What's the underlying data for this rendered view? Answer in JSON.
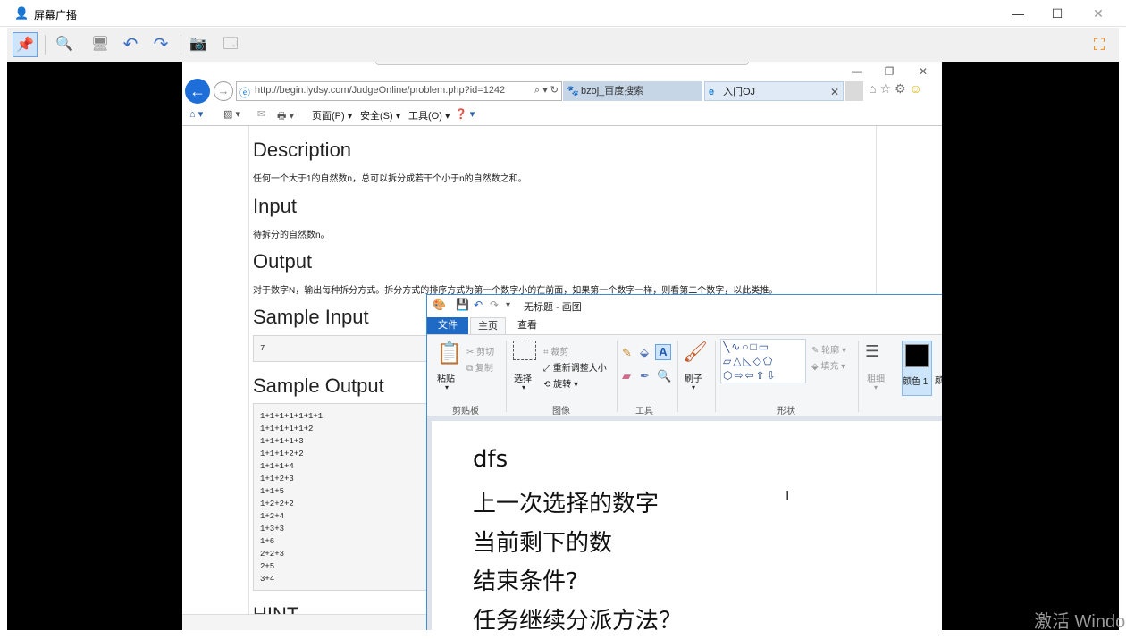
{
  "window": {
    "title": "屏幕广播",
    "controls": {
      "minimize": "—",
      "maximize": "☐",
      "close": "✕"
    }
  },
  "toolbar": {
    "buttons": [
      {
        "name": "pin-icon",
        "glyph": "📌"
      },
      {
        "name": "zoom-icon",
        "glyph": "🔍"
      },
      {
        "name": "monitor-icon",
        "glyph": "🖥"
      },
      {
        "name": "undo-icon",
        "glyph": "↶"
      },
      {
        "name": "redo-icon",
        "glyph": "↷"
      },
      {
        "name": "camera-icon",
        "glyph": "📷"
      },
      {
        "name": "screens-icon",
        "glyph": "🗔"
      }
    ],
    "fullscreen_glyph": "⛶"
  },
  "browser": {
    "controls": {
      "minimize": "—",
      "restore": "❐",
      "close": "✕"
    },
    "back_glyph": "←",
    "forward_glyph": "→",
    "url": "http://begin.lydsy.com/JudgeOnline/problem.php?id=1242",
    "addr_icons": "⌕ ▾ ↻",
    "tabs": [
      {
        "label": "bzoj_百度搜索",
        "icon": "🐾"
      },
      {
        "label": "入门OJ",
        "icon": "e"
      }
    ],
    "tab_close": "✕",
    "right_icons": "⌂☆⚙",
    "smiley": "☺",
    "commands": {
      "home": "⌂ ▾",
      "feeds": "▧ ▾",
      "mail": "✉",
      "print": "🖶 ▾",
      "page": "页面(P) ▾",
      "safety": "安全(S) ▾",
      "tools": "工具(O) ▾",
      "help": "❓ ▾"
    }
  },
  "problem": {
    "description_heading": "Description",
    "description_text": "任何一个大于1的自然数n，总可以拆分成若干个小于n的自然数之和。",
    "input_heading": "Input",
    "input_text": "待拆分的自然数n。",
    "output_heading": "Output",
    "output_text": "对于数字N，输出每种拆分方式。拆分方式的排序方式为第一个数字小的在前面，如果第一个数字一样，则看第二个数字，以此类推。",
    "sample_input_heading": "Sample Input",
    "sample_input_value": "7",
    "sample_output_heading": "Sample Output",
    "sample_output_lines": [
      "1+1+1+1+1+1+1",
      "1+1+1+1+1+2",
      "1+1+1+1+3",
      "1+1+1+2+2",
      "1+1+1+4",
      "1+1+2+3",
      "1+1+5",
      "1+2+2+2",
      "1+2+4",
      "1+3+3",
      "1+6",
      "2+2+3",
      "2+5",
      "3+4"
    ],
    "hint_heading": "HINT"
  },
  "paint": {
    "title": "无标题 - 画图",
    "tabs": {
      "file": "文件",
      "home": "主页",
      "view": "查看"
    },
    "clipboard": {
      "paste": "粘贴",
      "cut": "剪切",
      "copy": "复制",
      "label": "剪贴板"
    },
    "image": {
      "select": "选择",
      "crop": "裁剪",
      "resize": "重新调整大小",
      "rotate": "旋转 ▾",
      "label": "图像"
    },
    "tools": {
      "label": "工具"
    },
    "brush": {
      "label": "刷子"
    },
    "shapes": {
      "outline": "轮廓 ▾",
      "fill": "填充 ▾",
      "label": "形状",
      "row1": "╲∿○□▭",
      "row2": "▱△◺◇⬠",
      "row3": "⬡⇨⇦⇧⇩"
    },
    "size": {
      "label": "粗细"
    },
    "colors": {
      "color1": "颜色 1",
      "color2": "颜"
    },
    "canvas_lines": [
      "dfs",
      "上一次选择的数字",
      "当前剩下的数",
      "结束条件?",
      "任务继续分派方法？"
    ],
    "cursor_glyph": "I"
  },
  "watermark": "激活 Windo",
  "colors": {
    "accent_blue": "#1e6ac4",
    "paint_border": "#3b8fd8",
    "stage_bg": "#000000"
  }
}
